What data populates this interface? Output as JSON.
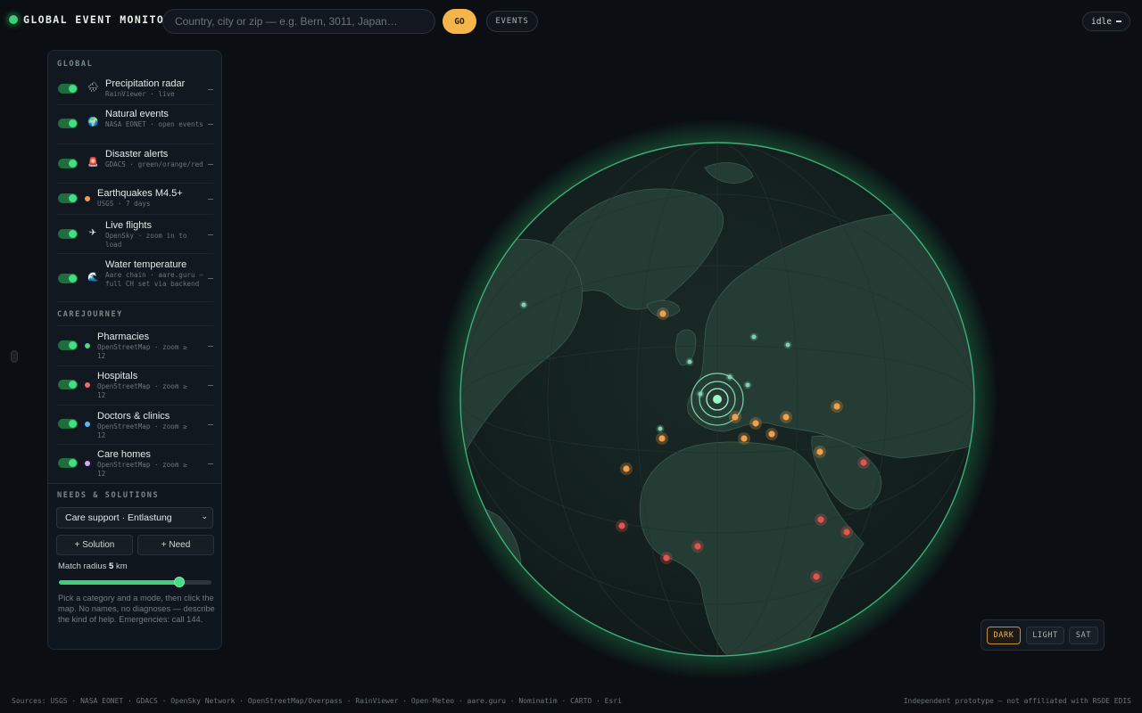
{
  "app": {
    "title": "GLOBAL EVENT MONITOR",
    "search_placeholder": "Country, city or zip — e.g. Bern, 3011, Japan…",
    "go_label": "GO",
    "events_label": "EVENTS",
    "status": "idle"
  },
  "panel": {
    "global_heading": "GLOBAL",
    "global_layers": [
      {
        "name": "Precipitation radar",
        "source": "RainViewer · live",
        "icon": "rain-cloud-icon",
        "glyph": "🌧",
        "enabled": true
      },
      {
        "name": "Natural events",
        "source": "NASA EONET · open events",
        "icon": "globe-icon",
        "glyph": "🌍",
        "enabled": true
      },
      {
        "name": "Disaster alerts",
        "source": "GDACS · green/orange/red",
        "icon": "siren-icon",
        "glyph": "🚨",
        "enabled": true
      },
      {
        "name": "Earthquakes M4.5+",
        "source": "USGS · 7 days",
        "icon": "earthquake-dot",
        "color": "#f0a04b",
        "enabled": true
      },
      {
        "name": "Live flights",
        "source": "OpenSky · zoom in to load",
        "icon": "airplane-icon",
        "glyph": "✈",
        "enabled": true
      },
      {
        "name": "Water temperature",
        "source": "Aare chain · aare.guru — full CH set via backend",
        "icon": "wave-icon",
        "glyph": "🌊",
        "enabled": true
      }
    ],
    "carejourney_heading": "CAREJOURNEY",
    "care_layers": [
      {
        "name": "Pharmacies",
        "source": "OpenStreetMap · zoom ≥ 12",
        "color": "#4fd48a",
        "enabled": true
      },
      {
        "name": "Hospitals",
        "source": "OpenStreetMap · zoom ≥ 12",
        "color": "#ef6b6b",
        "enabled": true
      },
      {
        "name": "Doctors & clinics",
        "source": "OpenStreetMap · zoom ≥ 12",
        "color": "#63b4f5",
        "enabled": true
      },
      {
        "name": "Care homes",
        "source": "OpenStreetMap · zoom ≥ 12",
        "color": "#d6a6f2",
        "enabled": true
      }
    ],
    "needs_heading": "NEEDS & SOLUTIONS",
    "category_selected": "Care support · Entlastung",
    "solution_button": "+ Solution",
    "need_button": "+ Need",
    "radius_label": "Match radius",
    "radius_value": "5",
    "radius_unit": "km",
    "radius_fraction": 0.79,
    "hint": "Pick a category and a mode, then click the map. No names, no diagnoses — describe the kind of help. Emergencies: call 144."
  },
  "map_style": {
    "options": [
      "DARK",
      "LIGHT",
      "SAT"
    ],
    "active": "DARK"
  },
  "colors": {
    "accent": "#f5b54a",
    "live": "#3bd07a",
    "event_orange": "#f0a04b",
    "event_red": "#e3544f",
    "event_teal": "#7fd3b2"
  },
  "footer": {
    "sources": "Sources: USGS · NASA EONET · GDACS · OpenSky Network · OpenStreetMap/Overpass · RainViewer · Open-Meteo · aare.guru · Nominatim · CARTO · Esri",
    "note": "Independent prototype — not affiliated with RSOE EDIS"
  }
}
